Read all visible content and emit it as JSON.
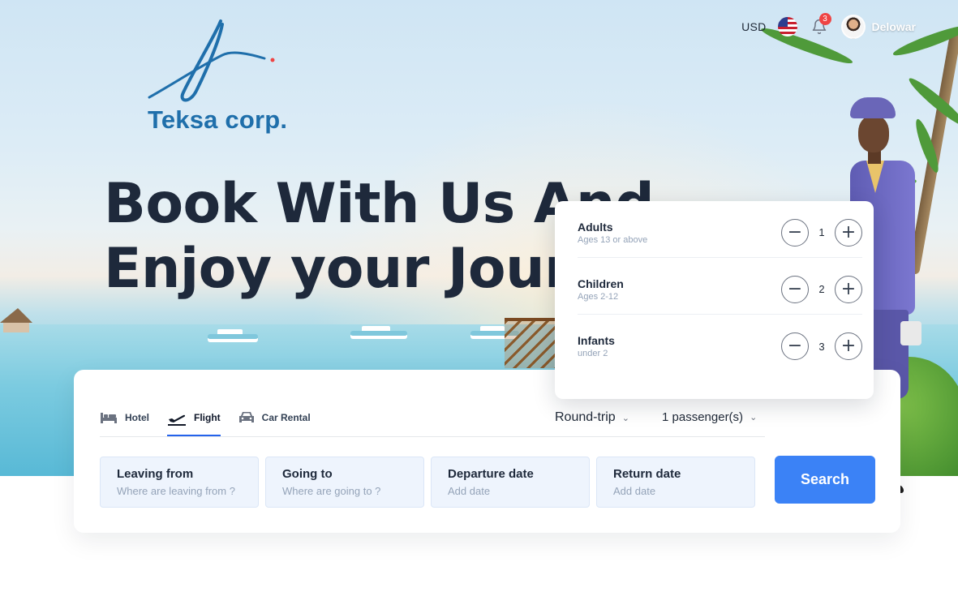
{
  "header": {
    "currency": "USD",
    "notification_count": "3",
    "user_name": "Delowar"
  },
  "logo": {
    "text": "Teksa corp."
  },
  "hero": {
    "line1": "Book With Us And",
    "line2": "Enjoy your Journey"
  },
  "tabs": [
    {
      "label": "Hotel",
      "icon": "bed-icon",
      "active": false
    },
    {
      "label": "Flight",
      "icon": "plane-takeoff-icon",
      "active": true
    },
    {
      "label": "Car Rental",
      "icon": "car-icon",
      "active": false
    }
  ],
  "trip_type": "Round-trip",
  "passengers_summary": "1 passenger(s)",
  "fields": [
    {
      "label": "Leaving from",
      "placeholder": "Where are leaving from ?"
    },
    {
      "label": "Going to",
      "placeholder": "Where are going to ?"
    },
    {
      "label": "Departure date",
      "placeholder": "Add date"
    },
    {
      "label": "Return date",
      "placeholder": "Add date"
    }
  ],
  "search_button": "Search",
  "passenger_panel": [
    {
      "title": "Adults",
      "subtitle": "Ages 13 or above",
      "count": "1"
    },
    {
      "title": "Children",
      "subtitle": "Ages 2-12",
      "count": "2"
    },
    {
      "title": "Infants",
      "subtitle": "under 2",
      "count": "3"
    }
  ],
  "colors": {
    "primary": "#3b82f6",
    "logo": "#1f6fab",
    "heading": "#1e293b"
  }
}
